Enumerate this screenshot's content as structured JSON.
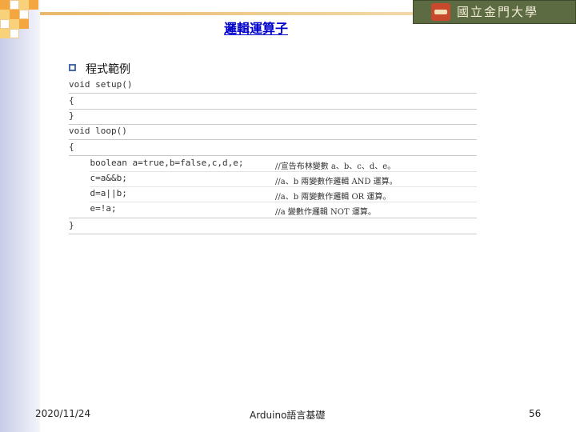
{
  "slide": {
    "title": "邏輯運算子",
    "logo_text": "國立金門大學",
    "bullet": "程式範例",
    "code_lines": [
      "void setup()",
      "{",
      "}",
      "void loop()",
      "{",
      "    boolean a=true,b=false,c,d,e;",
      "    c=a&&b;",
      "    d=a||b;",
      "    e=!a;",
      "}"
    ],
    "comments": [
      "//宣告布林變數 a、b、c、d、e。",
      "//a、b 兩變數作邏輯 AND 運算。",
      "//a、b 兩變數作邏輯 OR 運算。",
      "//a 變數作邏輯 NOT 運算。"
    ],
    "footer": {
      "date": "2020/11/24",
      "center": "Arduino語言基礎",
      "page": "56"
    },
    "colors": {
      "title": "#0000cc",
      "accent": "#f4a640",
      "band": "#c8cce8"
    }
  }
}
